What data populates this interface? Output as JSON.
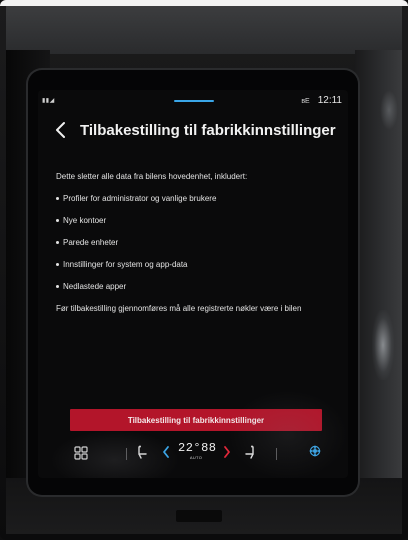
{
  "status_bar": {
    "signal_text": "▮▮◢",
    "bluetooth_label": "ʙE",
    "time": "12:11"
  },
  "header": {
    "back_icon": "chevron-left-icon",
    "title": "Tilbakestilling til fabrikkinnstillinger"
  },
  "content": {
    "intro": "Dette sletter alle data fra bilens hovedenhet, inkludert:",
    "items": [
      "Profiler for administrator og vanlige brukere",
      "Nye kontoer",
      "Parede enheter",
      "Innstillinger for system og app-data",
      "Nedlastede apper"
    ],
    "warning": "Før tilbakestilling gjennomføres må alle registrerte nøkler være i bilen"
  },
  "reset_button": {
    "label": "Tilbakestilling til fabrikkinnstillinger"
  },
  "climate_bar": {
    "temperature": "22°",
    "fan_display": "88",
    "mode": "AUTO",
    "icons": [
      "home-grid-icon",
      "seat-heat-left-icon",
      "temp-down-icon",
      "temp-up-icon",
      "seat-heat-right-icon",
      "fan-icon"
    ]
  },
  "colors": {
    "accent_blue": "#3aa6e8",
    "button_red": "#b3152a",
    "arrow_red": "#e1283a",
    "screen_bg": "#0a0a0b"
  }
}
